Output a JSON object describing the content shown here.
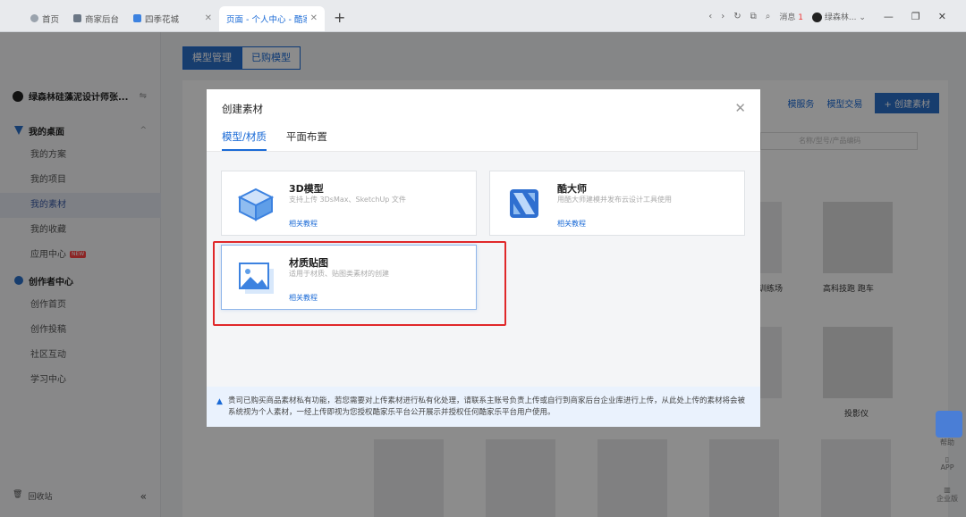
{
  "browser": {
    "tabs": [
      {
        "label": "首页",
        "active": false
      },
      {
        "label": "商家后台",
        "active": false
      },
      {
        "label": "四季花城",
        "active": false
      },
      {
        "label": "页面 - 个人中心 - 酷家",
        "active": true
      }
    ],
    "messages_label": "消息",
    "messages_count": "1",
    "user_name": "绿森林..."
  },
  "sidebar": {
    "user_name": "绿森林硅藻泥设计师张...",
    "groups": [
      {
        "label": "我的桌面",
        "items": [
          "我的方案",
          "我的项目",
          "我的素材",
          "我的收藏",
          "应用中心"
        ]
      },
      {
        "label": "创作者中心",
        "items": [
          "创作首页",
          "创作投稿",
          "社区互动",
          "学习中心"
        ]
      }
    ],
    "active_item": "我的素材",
    "new_badge": "NEW",
    "recycle_label": "回收站"
  },
  "main": {
    "tabs": [
      "模型管理",
      "已购模型"
    ],
    "links": [
      "模服务",
      "模型交易"
    ],
    "create_button": "+ 创建素材",
    "search_placeholder": "名称/型号/产品编码",
    "captions": [
      "训练场",
      "高科技跑 跑车",
      "投影仪"
    ]
  },
  "modal": {
    "title": "创建素材",
    "tabs": [
      "模型/材质",
      "平面布置"
    ],
    "cards": [
      {
        "title": "3D模型",
        "desc": "支持上传 3DsMax、SketchUp 文件",
        "link": "相关教程",
        "icon": "cube-icon"
      },
      {
        "title": "酷大师",
        "desc": "用酷大师建模并发布云设计工具使用",
        "link": "相关教程",
        "icon": "kudashi-icon"
      },
      {
        "title": "材质贴图",
        "desc": "适用于材质、贴图类素材的创建",
        "link": "相关教程",
        "icon": "image-icon"
      }
    ],
    "notice": "贵司已购买商品素材私有功能，若您需要对上传素材进行私有化处理，请联系主账号负责上传或自行到商家后台企业库进行上传，从此处上传的素材将会被系统视为个人素材，一经上传即视为您授权酷家乐平台公开展示并授权任何酷家乐平台用户使用。"
  },
  "floating": {
    "items": [
      "帮助",
      "APP",
      "企业版"
    ]
  },
  "colors": {
    "accent": "#1a6ad6",
    "highlight": "#e0282a"
  }
}
